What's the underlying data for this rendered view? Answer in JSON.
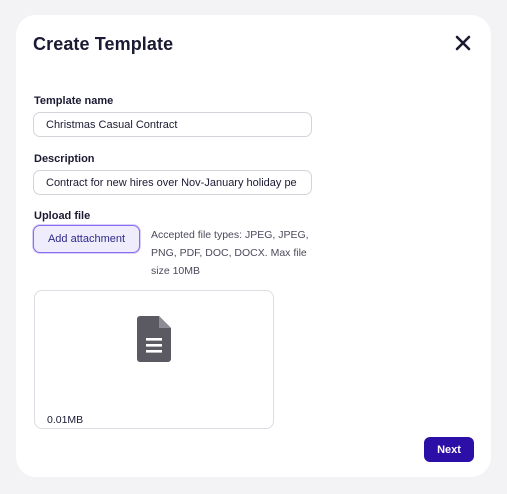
{
  "modal": {
    "title": "Create Template",
    "close_icon": "close-icon"
  },
  "form": {
    "template_name": {
      "label": "Template name",
      "value": "Christmas Casual Contract"
    },
    "description": {
      "label": "Description",
      "value": "Contract for new hires over Nov-January holiday pe"
    },
    "upload": {
      "label": "Upload file",
      "button_label": "Add attachment",
      "accepted_text": "Accepted file types: JPEG, JPEG, PNG, PDF, DOC, DOCX. Max file size 10MB"
    }
  },
  "attachment": {
    "icon": "document-icon",
    "size": "0.01MB"
  },
  "footer": {
    "next_label": "Next"
  },
  "colors": {
    "primary": "#2b0fa6",
    "accent_border": "#8a6cf0",
    "background": "#f3f3f6"
  }
}
